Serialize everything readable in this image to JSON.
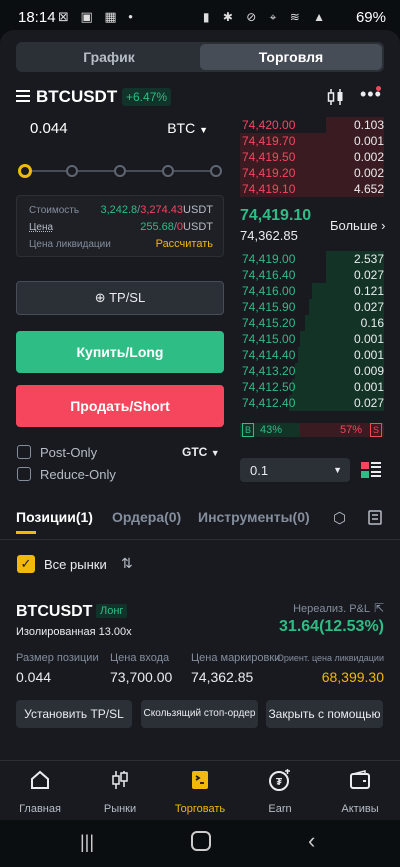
{
  "status": {
    "time": "18:14",
    "battery": "69%"
  },
  "top_tabs": [
    "График",
    "Торговля"
  ],
  "symbol": {
    "name": "BTCUSDT",
    "change": "+6.47%"
  },
  "order": {
    "qty": "0.044",
    "unit": "BTC",
    "cost_label": "Стоимость",
    "cost_green": "3,242.8",
    "cost_red": "3,274.43",
    "cost_unit": "USDT",
    "price_label": "Цена",
    "price_green": "255.68",
    "price_red": "0",
    "price_unit": "USDT",
    "liq_label": "Цена ликвидации",
    "liq_action": "Рассчитать",
    "tpsl": "TP/SL",
    "buy": "Купить/Long",
    "sell": "Продать/Short",
    "post_only": "Post-Only",
    "reduce_only": "Reduce-Only",
    "tif": "GTC"
  },
  "orderbook": {
    "asks": [
      {
        "p": "74,420.00",
        "q": "0.103"
      },
      {
        "p": "74,419.70",
        "q": "0.001"
      },
      {
        "p": "74,419.50",
        "q": "0.002"
      },
      {
        "p": "74,419.20",
        "q": "0.002"
      },
      {
        "p": "74,419.10",
        "q": "4.652"
      }
    ],
    "last": "74,419.10",
    "mark": "74,362.85",
    "more": "Больше",
    "bids": [
      {
        "p": "74,419.00",
        "q": "2.537"
      },
      {
        "p": "74,416.40",
        "q": "0.027"
      },
      {
        "p": "74,416.00",
        "q": "0.121"
      },
      {
        "p": "74,415.90",
        "q": "0.027"
      },
      {
        "p": "74,415.20",
        "q": "0.16"
      },
      {
        "p": "74,415.00",
        "q": "0.001"
      },
      {
        "p": "74,414.40",
        "q": "0.001"
      },
      {
        "p": "74,413.20",
        "q": "0.009"
      },
      {
        "p": "74,412.50",
        "q": "0.001"
      },
      {
        "p": "74,412.40",
        "q": "0.027"
      }
    ],
    "buy_ratio": "43%",
    "sell_ratio": "57%",
    "buy_tag": "B",
    "sell_tag": "S",
    "depth": "0.1"
  },
  "tabs": [
    "Позиции(1)",
    "Ордера(0)",
    "Инструменты(0)"
  ],
  "filter": {
    "all_markets": "Все рынки"
  },
  "position": {
    "symbol": "BTCUSDT",
    "side": "Лонг",
    "margin": "Изолированная 13.00x",
    "pnl_label": "Нереализ. P&L",
    "pnl": "31.64(12.53%)",
    "size_label": "Размер позиции",
    "size": "0.044",
    "entry_label": "Цена входа",
    "entry": "73,700.00",
    "mark_label": "Цена маркировки",
    "mark": "74,362.85",
    "liq_label": "Ориент. цена ликвидации",
    "liq": "68,399.30",
    "btn1": "Установить TP/SL",
    "btn2": "Скользящий стоп-ордер",
    "btn3": "Закрыть с помощью"
  },
  "nav": [
    "Главная",
    "Рынки",
    "Торговать",
    "Earn",
    "Активы"
  ],
  "colors": {
    "green": "#2ebd85",
    "red": "#f6465d",
    "accent": "#f0b90b"
  }
}
